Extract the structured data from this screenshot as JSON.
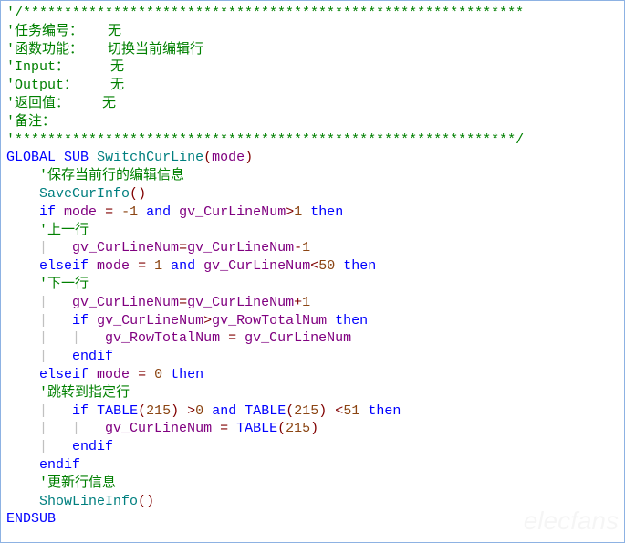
{
  "header_comment": {
    "border_top": "'/*************************************************************",
    "task_no": "'任务编号：   无",
    "func_desc": "'函数功能：   切换当前编辑行",
    "input": "'Input：     无",
    "output": "'Output：    无",
    "retval": "'返回值：    无",
    "remark": "'备注：",
    "border_bot": "'*************************************************************/"
  },
  "code": {
    "global": "GLOBAL",
    "sub": "SUB",
    "func_name": "SwitchCurLine",
    "param": "mode",
    "c1": "'保存当前行的编辑信息",
    "save_func": "SaveCurInfo",
    "if": "if",
    "mode": "mode",
    "eq": "=",
    "neg1": "-1",
    "and": "and",
    "gv_curline": "gv_CurLineNum",
    "gt": ">",
    "one": "1",
    "then": "then",
    "c2": "'上一行",
    "minus1_expr_lhs": "gv_CurLineNum",
    "minus1_expr_rhs": "gv_CurLineNum",
    "elseif": "elseif",
    "pos1": "1",
    "lt": "<",
    "fifty": "50",
    "c3": "'下一行",
    "plus1_expr_lhs": "gv_CurLineNum",
    "plus1_expr_rhs": "gv_CurLineNum",
    "gv_rowtotal": "gv_RowTotalNum",
    "endif": "endif",
    "zero": "0",
    "c4": "'跳转到指定行",
    "table": "TABLE",
    "table_idx": "215",
    "fiftyone": "51",
    "c5": "'更新行信息",
    "show_func": "ShowLineInfo",
    "endsub": "ENDSUB",
    "lp": "(",
    "rp": ")",
    "dash": "-",
    "plus": "+",
    "pipe": "|   "
  },
  "watermark": "elecfans"
}
